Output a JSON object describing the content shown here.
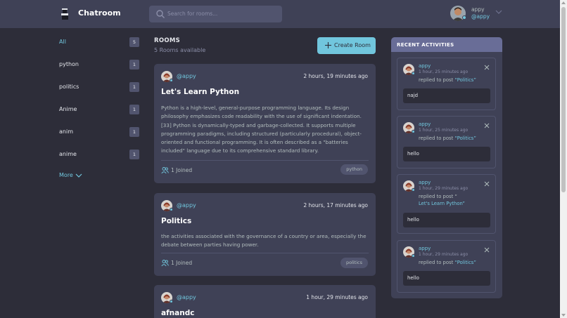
{
  "header": {
    "brand": "Chatroom",
    "search_placeholder": "Search for rooms...",
    "user_name": "appy",
    "user_handle": "@appy"
  },
  "topics": [
    {
      "label": "All",
      "count": "5",
      "active": true
    },
    {
      "label": "python",
      "count": "1"
    },
    {
      "label": "politics",
      "count": "1"
    },
    {
      "label": "Anime",
      "count": "1"
    },
    {
      "label": "anim",
      "count": "1"
    },
    {
      "label": "anime",
      "count": "1"
    }
  ],
  "more_label": "More",
  "rooms": {
    "title": "ROOMS",
    "count_text": "5 Rooms available",
    "create_label": "Create Room",
    "items": [
      {
        "host": "@appy",
        "time": "2 hours, 19 minutes ago",
        "title": "Let's Learn Python",
        "description": "Python is a high-level, general-purpose programming language. Its design philosophy emphasizes code readability with the use of significant indentation.[33] Python is dynamically-typed and garbage-collected. It supports multiple programming paradigms, including structured (particularly procedural), object-oriented and functional programming. It is often described as a \"batteries included\" language due to its comprehensive standard library.",
        "joined": "1 Joined",
        "topic": "python"
      },
      {
        "host": "@appy",
        "time": "2 hours, 17 minutes ago",
        "title": "Politics",
        "description": "the activities associated with the governance of a country or area, especially the debate between parties having power.",
        "joined": "1 Joined",
        "topic": "politics"
      },
      {
        "host": "@appy",
        "time": "1 hour, 29 minutes ago",
        "title": "afnandc"
      }
    ]
  },
  "activities": {
    "title": "RECENT ACTIVITIES",
    "items": [
      {
        "user": "appy",
        "time": "1 hour, 25 minutes ago",
        "prefix": "replied to post ",
        "post": "“Politics”",
        "message": "najd"
      },
      {
        "user": "appy",
        "time": "1 hour, 25 minutes ago",
        "prefix": "replied to post ",
        "post": "“Politics”",
        "message": "hello"
      },
      {
        "user": "appy",
        "time": "1 hour, 29 minutes ago",
        "prefix": "replied to post “",
        "post": "Let's Learn Python”",
        "message": "hello"
      },
      {
        "user": "appy",
        "time": "1 hour, 29 minutes ago",
        "prefix": "replied to post ",
        "post": "“Politics”",
        "message": "hello"
      }
    ]
  },
  "colors": {
    "background": "#2d2d39",
    "panel": "#3f4156",
    "accent": "#71c6dd",
    "activity_header": "#696d97"
  }
}
